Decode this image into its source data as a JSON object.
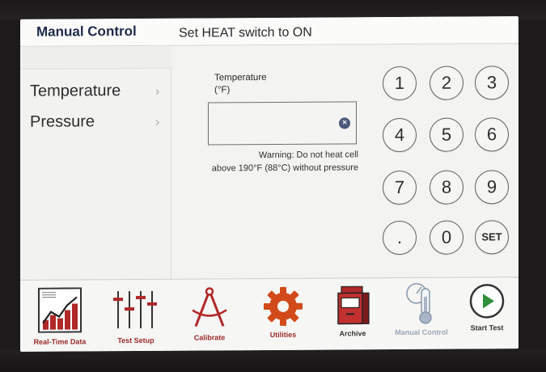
{
  "header": {
    "title": "Manual Control",
    "status": "Set HEAT switch to ON"
  },
  "menu": {
    "items": [
      {
        "label": "Temperature",
        "chevron": "›"
      },
      {
        "label": "Pressure",
        "chevron": "›"
      }
    ]
  },
  "entry": {
    "label_line1": "Temperature",
    "label_line2": "(°F)",
    "value": "",
    "clear_icon": "close-icon",
    "warning_line1": "Warning: Do not heat cell",
    "warning_line2": "above 190°F (88°C) without pressure"
  },
  "keypad": {
    "keys": [
      "1",
      "2",
      "3",
      "4",
      "5",
      "6",
      "7",
      "8",
      "9",
      ".",
      "0",
      "SET"
    ]
  },
  "toolbar": {
    "items": [
      {
        "label": "Real-Time Data",
        "icon": "chart-icon"
      },
      {
        "label": "Test Setup",
        "icon": "sliders-icon"
      },
      {
        "label": "Calibrate",
        "icon": "compass-icon"
      },
      {
        "label": "Utilities",
        "icon": "gear-icon"
      },
      {
        "label": "Archive",
        "icon": "file-cabinet-icon"
      },
      {
        "label": "Manual Control",
        "icon": "thermometer-icon"
      },
      {
        "label": "Start Test",
        "icon": "play-icon"
      }
    ]
  },
  "colors": {
    "accent": "#9b2a2a",
    "gear": "#d24a1a",
    "header_text": "#1d2a4a",
    "disabled": "#9aa6b6",
    "play": "#2f8f3a"
  }
}
